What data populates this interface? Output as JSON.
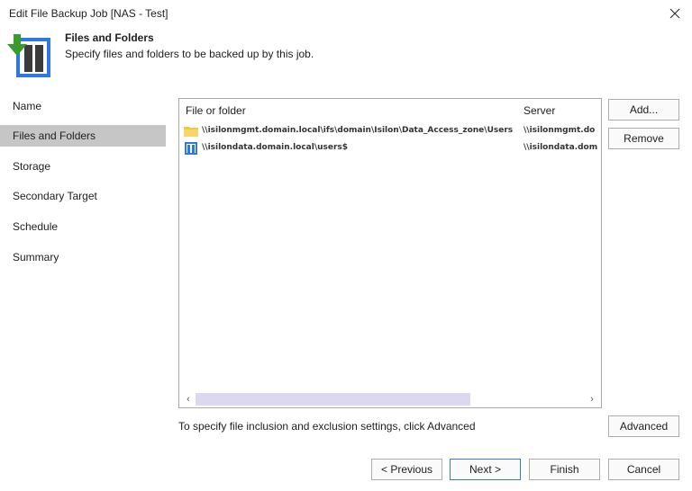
{
  "window": {
    "title": "Edit File Backup Job [NAS - Test]",
    "close_icon": "close-icon"
  },
  "header": {
    "icon": "file-backup-icon",
    "title": "Files and Folders",
    "subtitle": "Specify files and folders to be backed up by this job."
  },
  "nav": {
    "items": [
      {
        "label": "Name",
        "active": false
      },
      {
        "label": "Files and Folders",
        "active": true
      },
      {
        "label": "Storage",
        "active": false
      },
      {
        "label": "Secondary Target",
        "active": false
      },
      {
        "label": "Schedule",
        "active": false
      },
      {
        "label": "Summary",
        "active": false
      }
    ]
  },
  "list": {
    "columns": [
      "File or folder",
      "Server"
    ],
    "rows": [
      {
        "icon": "folder-icon",
        "path": "\\\\isilonmgmt.domain.local\\ifs\\domain\\Isilon\\Data_Access_zone\\Users",
        "server": "\\\\isilonmgmt.do"
      },
      {
        "icon": "share-icon",
        "path": "\\\\isilondata.domain.local\\users$",
        "server": "\\\\isilondata.dom"
      }
    ],
    "scroll_left": "‹",
    "scroll_right": "›"
  },
  "side_buttons": {
    "add": "Add...",
    "remove": "Remove"
  },
  "hint": "To specify file inclusion and exclusion settings, click Advanced",
  "advanced_button": "Advanced",
  "footer": {
    "previous": "< Previous",
    "next": "Next >",
    "finish": "Finish",
    "cancel": "Cancel"
  },
  "colors": {
    "accent": "#3c7bd4",
    "nav_active": "#c6c6c6",
    "icon_green": "#3a9a2f",
    "icon_blue": "#2f7ad6",
    "folder_yellow": "#f2c744"
  }
}
